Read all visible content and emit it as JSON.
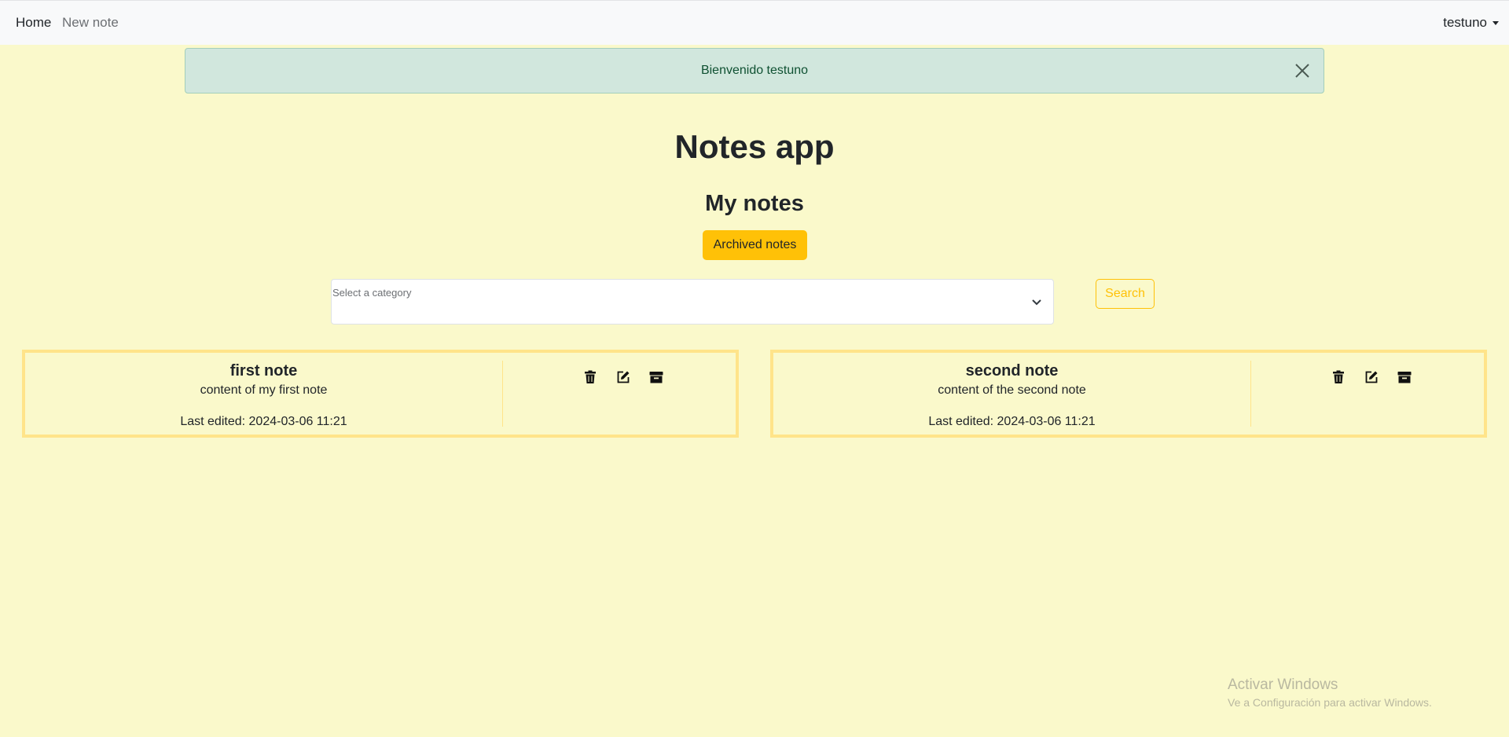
{
  "nav": {
    "home": "Home",
    "new_note": "New note",
    "user": "testuno"
  },
  "alert": {
    "message": "Bienvenido testuno"
  },
  "page": {
    "title": "Notes app",
    "subtitle": "My notes",
    "archived_button": "Archived notes"
  },
  "filter": {
    "select_label": "Select a category",
    "search_button": "Search"
  },
  "notes": [
    {
      "title": "first note",
      "content": "content of my first note",
      "last_edited": "Last edited: 2024-03-06 11:21"
    },
    {
      "title": "second note",
      "content": "content of the second note",
      "last_edited": "Last edited: 2024-03-06 11:21"
    }
  ],
  "icons": {
    "delete": "trash-icon",
    "edit": "edit-icon",
    "archive": "archive-icon",
    "close": "close-icon",
    "chevron": "chevron-down-icon"
  },
  "colors": {
    "background": "#faf9cb",
    "navbar": "#f8f9fa",
    "alert_bg": "#d1e7dd",
    "warning": "#ffc107",
    "card_border": "#ffe48a"
  },
  "watermark": {
    "title": "Activar Windows",
    "subtitle": "Ve a Configuración para activar Windows."
  }
}
